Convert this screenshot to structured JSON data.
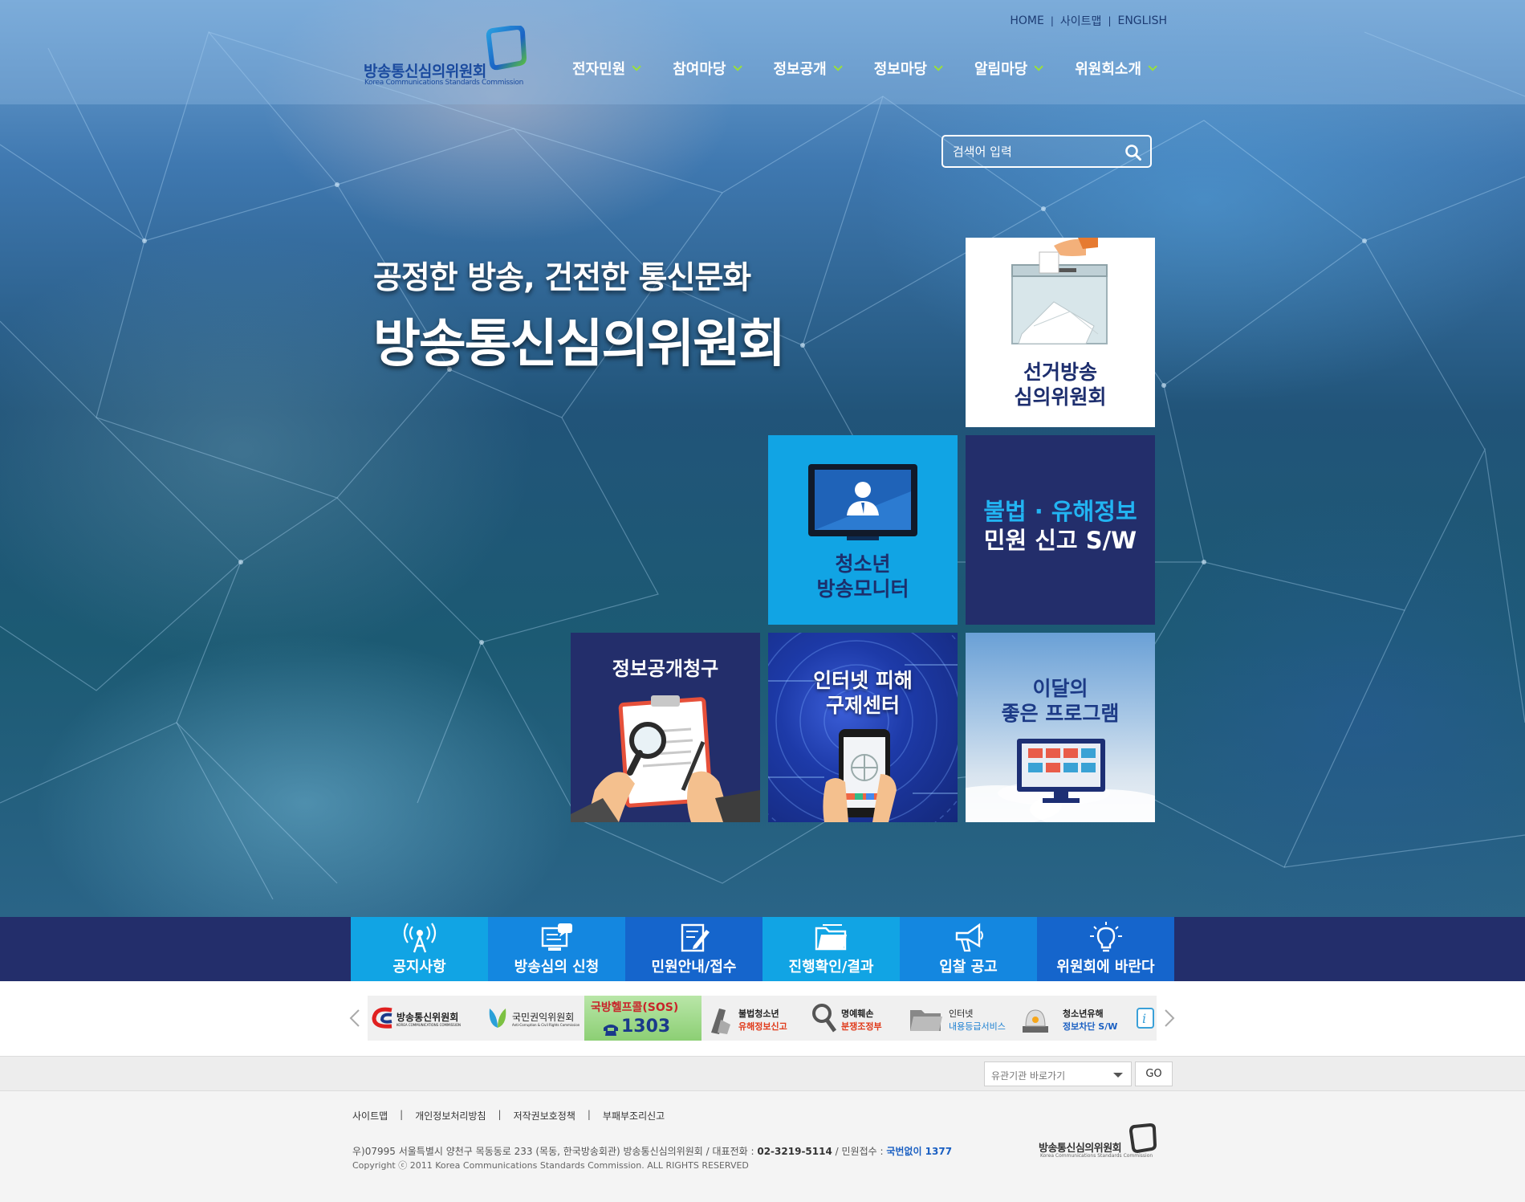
{
  "header": {
    "logo_ko": "방송통신심의위원회",
    "logo_en": "Korea Communications Standards Commission",
    "util_links": [
      "HOME",
      "사이트맵",
      "ENGLISH"
    ],
    "menu": [
      "전자민원",
      "참여마당",
      "정보공개",
      "정보마당",
      "알림마당",
      "위원회소개"
    ]
  },
  "search": {
    "placeholder": "검색어 입력"
  },
  "hero": {
    "subtitle": "공정한 방송, 건전한 통신문화",
    "title": "방송통신심의위원회"
  },
  "tiles": {
    "election": [
      "선거방송",
      "심의위원회"
    ],
    "youth": [
      "청소년",
      "방송모니터"
    ],
    "illegal": [
      "불법 · 유해정보",
      "민원 신고 S/W"
    ],
    "info_request": [
      "정보공개청구"
    ],
    "internet": [
      "인터넷 피해",
      "구제센터"
    ],
    "program": [
      "이달의",
      "좋은 프로그램"
    ]
  },
  "quick_menu": [
    {
      "label": "공지사항",
      "icon": "antenna-icon",
      "color": "#11a4e4"
    },
    {
      "label": "방송심의 신청",
      "icon": "monitor-chat-icon",
      "color": "#1487e0"
    },
    {
      "label": "민원안내/접수",
      "icon": "document-pen-icon",
      "color": "#1565cc"
    },
    {
      "label": "진행확인/결과",
      "icon": "folder-icon",
      "color": "#11a4e4"
    },
    {
      "label": "입찰 공고",
      "icon": "megaphone-icon",
      "color": "#1487e0"
    },
    {
      "label": "위원회에 바란다",
      "icon": "lightbulb-icon",
      "color": "#1565cc"
    }
  ],
  "banners": {
    "kcc": "방송통신위원회",
    "kcc_en": "KOREA COMMUNICATIONS COMMISSION",
    "acrc": "국민권익위원회",
    "acrc_en": "Anti-Corruption & Civil Rights Commission",
    "sos_title": "국방헬프콜(SOS)",
    "sos_number": "1303",
    "illegal_l1": "불법청소년",
    "illegal_l2": "유해정보신고",
    "defam_l1": "명예훼손",
    "defam_l2": "분쟁조정부",
    "rating_l1": "인터넷",
    "rating_l2": "내용등급서비스",
    "block_l1": "청소년유해",
    "block_l2": "정보차단 S/W"
  },
  "family": {
    "select_label": "유관기관 바로가기",
    "go": "GO"
  },
  "footer": {
    "links": [
      "사이트맵",
      "개인정보처리방침",
      "저작권보호정책",
      "부패부조리신고"
    ],
    "address": "우)07995 서울특별시 양천구 목동동로 233 (목동, 한국방송회관) 방송통신심의위원회 / 대표전화 : ",
    "phone": "02-3219-5114",
    "civil_label": " / 민원접수 : ",
    "civil": "국번없이 1377",
    "copyright": "Copyright ⓒ 2011 Korea Communications Standards Commission. ALL RIGHTS RESERVED",
    "logo_ko": "방송통신심의위원회",
    "logo_en": "Korea Communications Standards Commission"
  },
  "colors": {
    "navy": "#232e6b",
    "sky": "#11a4e4",
    "accent_green": "#9be03a"
  }
}
